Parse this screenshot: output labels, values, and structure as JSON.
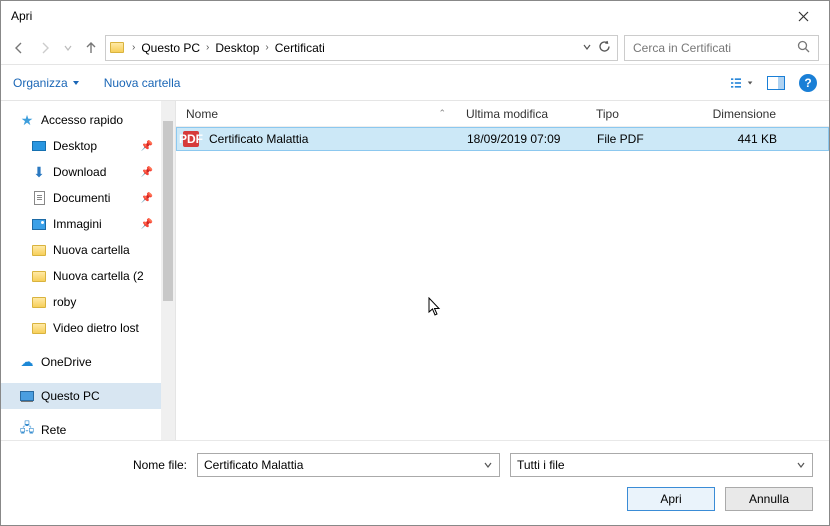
{
  "window": {
    "title": "Apri"
  },
  "breadcrumb": {
    "pc": "Questo PC",
    "desktop": "Desktop",
    "folder": "Certificati"
  },
  "search": {
    "placeholder": "Cerca in Certificati"
  },
  "toolbar": {
    "organize": "Organizza",
    "new_folder": "Nuova cartella"
  },
  "sidebar": {
    "quick_access": "Accesso rapido",
    "desktop": "Desktop",
    "download": "Download",
    "documents": "Documenti",
    "images": "Immagini",
    "new_folder": "Nuova cartella",
    "new_folder2": "Nuova cartella (2",
    "roby": "roby",
    "video": "Video dietro lost",
    "onedrive": "OneDrive",
    "this_pc": "Questo PC",
    "network": "Rete"
  },
  "columns": {
    "name": "Nome",
    "modified": "Ultima modifica",
    "type": "Tipo",
    "size": "Dimensione"
  },
  "file": {
    "name": "Certificato Malattia",
    "date": "18/09/2019 07:09",
    "type": "File PDF",
    "size": "441 KB",
    "icon_label": "PDF"
  },
  "footer": {
    "filename_label": "Nome file:",
    "filename_value": "Certificato Malattia",
    "filter": "Tutti i file",
    "open": "Apri",
    "cancel": "Annulla"
  },
  "help_glyph": "?"
}
